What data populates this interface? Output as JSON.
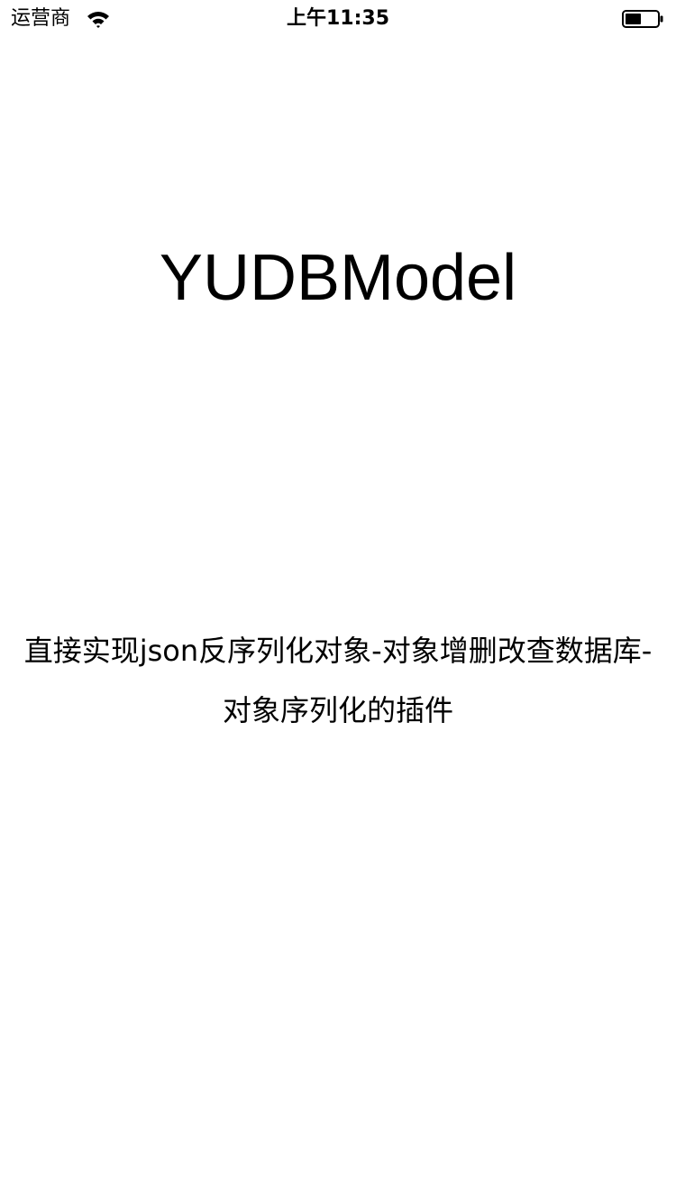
{
  "status_bar": {
    "carrier": "运营商",
    "time": "上午11:35",
    "wifi_icon": "wifi-icon",
    "battery_icon": "battery-icon",
    "battery_level": 0.5
  },
  "main": {
    "title": "YUDBModel",
    "description": "直接实现json反序列化对象-对象增删改查数据库-对象序列化的插件"
  }
}
